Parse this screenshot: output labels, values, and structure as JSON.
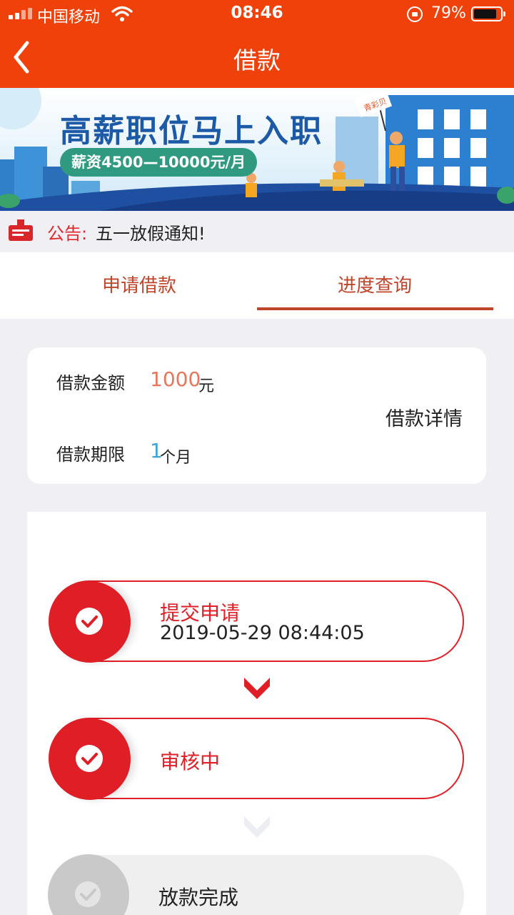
{
  "status_bar": {
    "carrier": "中国移动",
    "time": "08:46",
    "battery": "79%"
  },
  "nav": {
    "title": "借款"
  },
  "banner": {
    "title": "高薪职位马上入职",
    "subtitle": "薪资4500—10000元/月",
    "flag": "青彩贝"
  },
  "notice": {
    "label": "公告:",
    "text": "五一放假通知!"
  },
  "tabs": [
    {
      "label": "申请借款",
      "active": false
    },
    {
      "label": "进度查询",
      "active": true
    }
  ],
  "loan": {
    "amount_label": "借款金额",
    "amount": "1000",
    "amount_unit": "元",
    "term_label": "借款期限",
    "term": "1",
    "term_unit": "个月",
    "detail_link": "借款详情"
  },
  "steps": [
    {
      "title": "提交申请",
      "time": "2019-05-29 08:44:05",
      "state": "done"
    },
    {
      "title": "审核中",
      "time": "",
      "state": "done"
    },
    {
      "title": "放款完成",
      "time": "",
      "state": "pending"
    }
  ],
  "colors": {
    "brand": "#f0410a",
    "accent": "#e21f26",
    "tab": "#c0442a",
    "amount": "#e8765c",
    "term": "#3aa6d8"
  }
}
